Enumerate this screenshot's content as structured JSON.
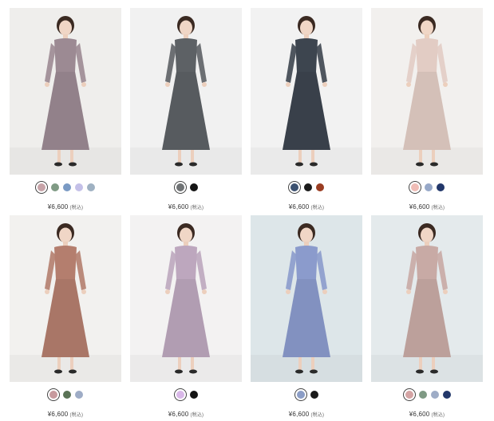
{
  "products": [
    {
      "price": "¥6,600",
      "tax": "(税込)",
      "bg": "#efeeec",
      "dress_color": "#9c8a93",
      "swatches": [
        {
          "color": "#c7a3a8",
          "selected": true
        },
        {
          "color": "#7f9a84",
          "selected": false
        },
        {
          "color": "#7a9ac4",
          "selected": false
        },
        {
          "color": "#c4c0e8",
          "selected": false
        },
        {
          "color": "#9fb1c2",
          "selected": false
        }
      ]
    },
    {
      "price": "¥6,600",
      "tax": "(税込)",
      "bg": "#f1f1f1",
      "dress_color": "#5d6165",
      "swatches": [
        {
          "color": "#6f7274",
          "selected": true
        },
        {
          "color": "#141414",
          "selected": false
        }
      ]
    },
    {
      "price": "¥6,600",
      "tax": "(税込)",
      "bg": "#f2f2f2",
      "dress_color": "#3d454f",
      "swatches": [
        {
          "color": "#3c5170",
          "selected": true
        },
        {
          "color": "#1c1c1c",
          "selected": false
        },
        {
          "color": "#9a3d22",
          "selected": false
        }
      ]
    },
    {
      "price": "¥6,600",
      "tax": "(税込)",
      "bg": "#f2f0ee",
      "dress_color": "#e2ccc4",
      "swatches": [
        {
          "color": "#efbcb6",
          "selected": true
        },
        {
          "color": "#97a8c8",
          "selected": false
        },
        {
          "color": "#22376a",
          "selected": false
        }
      ]
    },
    {
      "price": "¥6,600",
      "tax": "(税込)",
      "bg": "#f2f1ef",
      "dress_color": "#b47e6e",
      "swatches": [
        {
          "color": "#c79a9e",
          "selected": true
        },
        {
          "color": "#5a7356",
          "selected": false
        },
        {
          "color": "#9eacc6",
          "selected": false
        }
      ]
    },
    {
      "price": "¥6,600",
      "tax": "(税込)",
      "bg": "#f3f2f2",
      "dress_color": "#bda7be",
      "swatches": [
        {
          "color": "#d9b8e8",
          "selected": true
        },
        {
          "color": "#141414",
          "selected": false
        }
      ]
    },
    {
      "price": "¥6,600",
      "tax": "(税込)",
      "bg": "#dde6e9",
      "dress_color": "#8b9bcc",
      "swatches": [
        {
          "color": "#8b9dc6",
          "selected": true
        },
        {
          "color": "#1a1a1a",
          "selected": false
        }
      ]
    },
    {
      "price": "¥6,600",
      "tax": "(税込)",
      "bg": "#e4eaec",
      "dress_color": "#c8aaa5",
      "swatches": [
        {
          "color": "#d4a4a4",
          "selected": true
        },
        {
          "color": "#7f9a84",
          "selected": false
        },
        {
          "color": "#9eacc6",
          "selected": false
        },
        {
          "color": "#22376a",
          "selected": false
        }
      ]
    }
  ]
}
